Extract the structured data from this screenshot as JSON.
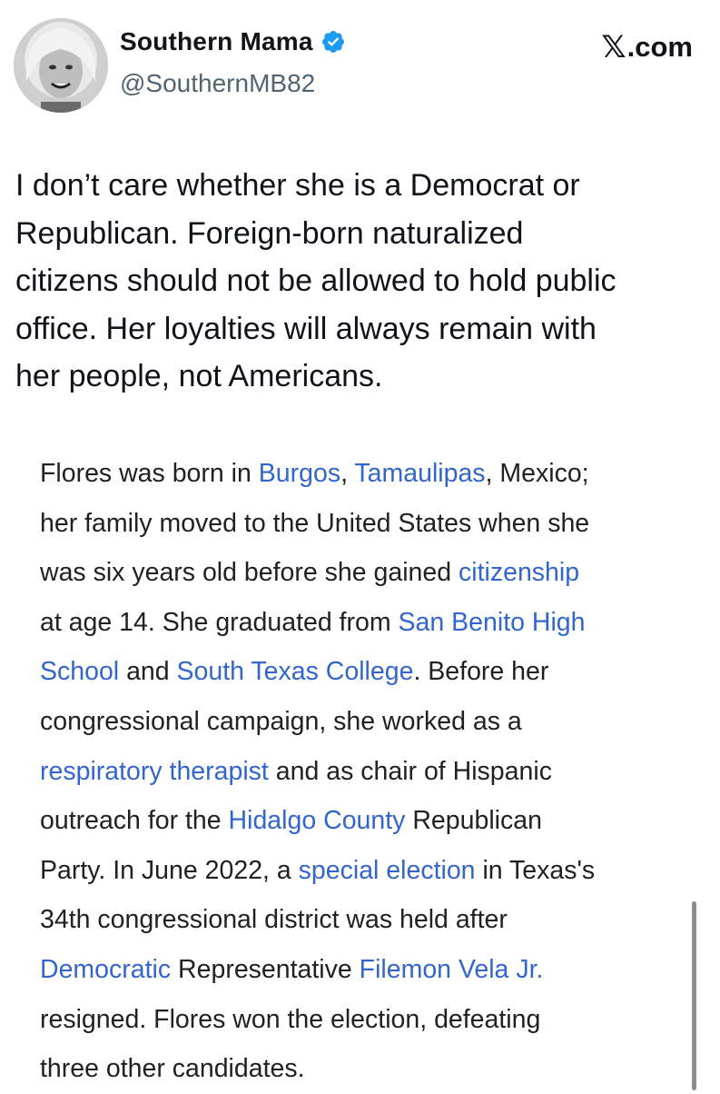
{
  "header": {
    "display_name": "Southern Mama",
    "handle": "@SouthernMB82",
    "site_label": ".com",
    "x_logo": "𝕏"
  },
  "icons": {
    "verified": "verified-badge-icon",
    "avatar": "profile-avatar"
  },
  "colors": {
    "verified_blue": "#1d9bf0",
    "link_blue": "#3366cc",
    "handle_gray": "#536471",
    "body_text": "#202122"
  },
  "tweet": {
    "lines": [
      "I don’t care whether she is a Democrat or",
      "Republican. Foreign-born naturalized",
      "citizens should not be allowed to hold public",
      "office. Her loyalties will always remain with",
      "her people, not Americans."
    ]
  },
  "wiki": {
    "lines": [
      [
        {
          "t": "Flores was born in "
        },
        {
          "t": "Burgos",
          "link": true
        },
        {
          "t": ", "
        },
        {
          "t": "Tamaulipas",
          "link": true
        },
        {
          "t": ", Mexico;"
        }
      ],
      [
        {
          "t": "her family moved to the United States when she"
        }
      ],
      [
        {
          "t": "was six years old before she gained "
        },
        {
          "t": "citizenship",
          "link": true
        }
      ],
      [
        {
          "t": "at age 14. She graduated from "
        },
        {
          "t": "San Benito High",
          "link": true
        }
      ],
      [
        {
          "t": "School",
          "link": true
        },
        {
          "t": " and "
        },
        {
          "t": "South Texas College",
          "link": true
        },
        {
          "t": ". Before her"
        }
      ],
      [
        {
          "t": "congressional campaign, she worked as a"
        }
      ],
      [
        {
          "t": "respiratory therapist",
          "link": true
        },
        {
          "t": " and as chair of Hispanic"
        }
      ],
      [
        {
          "t": "outreach for the "
        },
        {
          "t": "Hidalgo County",
          "link": true
        },
        {
          "t": " Republican"
        }
      ],
      [
        {
          "t": "Party. In June 2022, a "
        },
        {
          "t": "special election",
          "link": true
        },
        {
          "t": " in Texas's"
        }
      ],
      [
        {
          "t": "34th congressional district was held after"
        }
      ],
      [
        {
          "t": "Democratic",
          "link": true
        },
        {
          "t": " Representative "
        },
        {
          "t": "Filemon Vela Jr.",
          "link": true
        }
      ],
      [
        {
          "t": "resigned. Flores won the election, defeating"
        }
      ],
      [
        {
          "t": "three other candidates."
        }
      ]
    ]
  }
}
